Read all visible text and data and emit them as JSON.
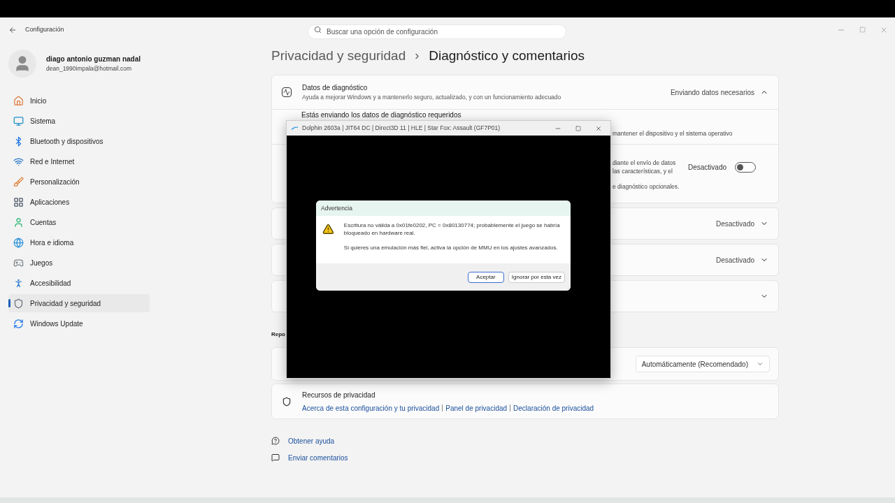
{
  "window": {
    "title": "Configuración",
    "search": {
      "placeholder": "Buscar una opción de configuración"
    }
  },
  "account": {
    "name": "diago antonio guzman nadal",
    "email": "dean_1990impala@hotmail.com"
  },
  "sidebar": {
    "items": [
      {
        "kind": "home",
        "label": "Inicio",
        "selected": false
      },
      {
        "kind": "system",
        "label": "Sistema",
        "selected": false
      },
      {
        "kind": "bluetooth",
        "label": "Bluetooth y dispositivos",
        "selected": false
      },
      {
        "kind": "network",
        "label": "Red e Internet",
        "selected": false
      },
      {
        "kind": "personalize",
        "label": "Personalización",
        "selected": false
      },
      {
        "kind": "apps",
        "label": "Aplicaciones",
        "selected": false
      },
      {
        "kind": "accounts",
        "label": "Cuentas",
        "selected": false
      },
      {
        "kind": "time",
        "label": "Hora e idioma",
        "selected": false
      },
      {
        "kind": "games",
        "label": "Juegos",
        "selected": false
      },
      {
        "kind": "accessibility",
        "label": "Accesibilidad",
        "selected": false
      },
      {
        "kind": "privacy",
        "label": "Privacidad y seguridad",
        "selected": true
      },
      {
        "kind": "update",
        "label": "Windows Update",
        "selected": false
      }
    ]
  },
  "breadcrumb": {
    "parent": "Privacidad y seguridad",
    "current": "Diagnóstico y comentarios"
  },
  "diagnostic": {
    "title": "Datos de diagnóstico",
    "subtitle": "Ayuda a mejorar Windows y a mantenerlo seguro, actualizado, y con un funcionamiento adecuado",
    "value": "Enviando datos necesarios",
    "expanded": true,
    "required_heading": "Estás enviando los datos de diagnóstico requeridos",
    "required_fragment": "mantener el dispositivo y el sistema operativo",
    "optional_fragments": [
      "diante el envío de datos",
      "las características, y el"
    ],
    "toggle_label": "Desactivado",
    "on": false,
    "optional_note": "e diagnóstico opcionales."
  },
  "rows": [
    {
      "kind": "value",
      "value": "Desactivado"
    },
    {
      "kind": "value",
      "value": "Desactivado"
    },
    {
      "kind": "chevron"
    }
  ],
  "section_heading": "Repo",
  "frequency": {
    "value": "Automáticamente (Recomendado)"
  },
  "privacy_resources": {
    "title": "Recursos de privacidad",
    "links": [
      "Acerca de esta configuración y tu privacidad",
      "Panel de privacidad",
      "Declaración de privacidad"
    ]
  },
  "help_links": [
    {
      "kind": "help",
      "label": "Obtener ayuda"
    },
    {
      "kind": "feedback",
      "label": "Enviar comentarios"
    }
  ],
  "emulator": {
    "title": "Dolphin 2603a | JIT64 DC | Direct3D 11 | HLE | Star Fox: Assault (GF7P01)",
    "dialog": {
      "title": "Advertencia",
      "message": "Escritura no válida a 0x01fe0202, PC = 0x80130774; probablemente el juego se habría bloqueado en hardware real.",
      "hint": "Si quieres una emulación más fiel, activa la opción de MMU en los ajustes avanzados.",
      "buttons": [
        {
          "label": "Aceptar",
          "selected": true
        },
        {
          "label": "Ignorar por esta vez",
          "selected": false
        }
      ]
    }
  }
}
